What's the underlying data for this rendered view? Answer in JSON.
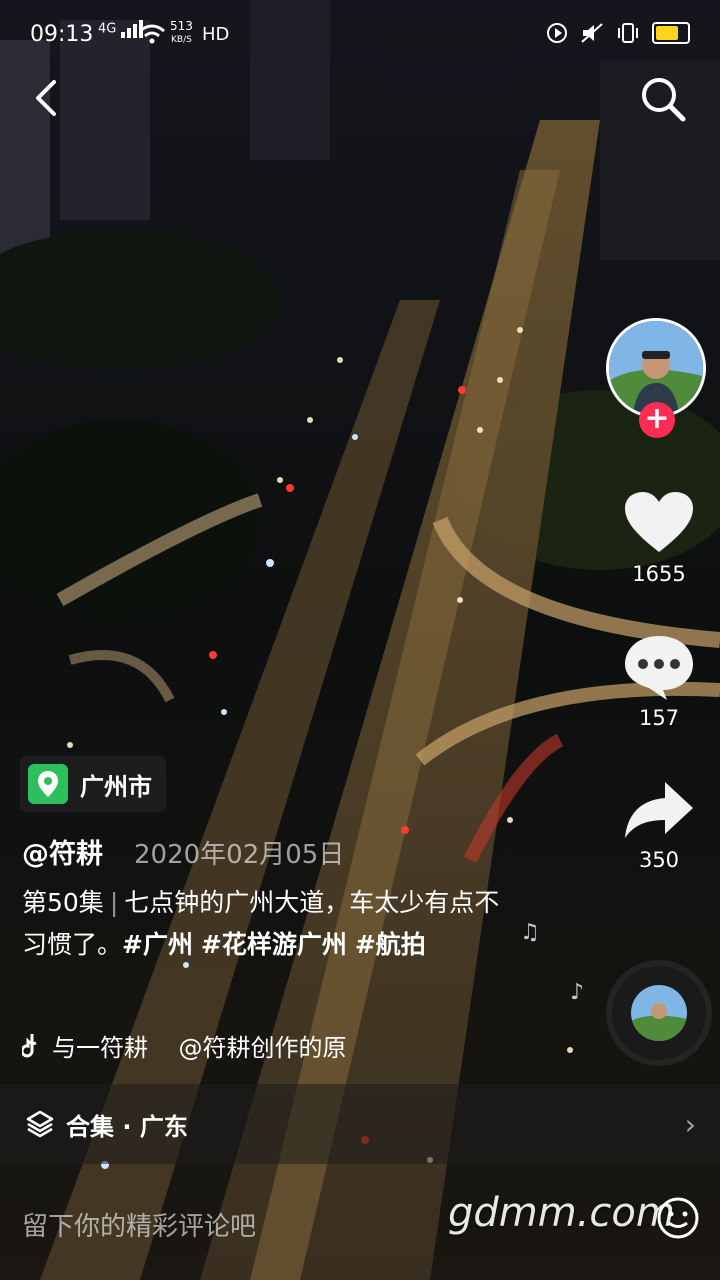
{
  "status_bar": {
    "time": "09:13",
    "network": "4G",
    "speed_value": "513",
    "speed_unit": "KB/S",
    "hd": "HD"
  },
  "location": {
    "name": "广州市"
  },
  "post": {
    "author": "@符耕",
    "date": "2020年02月05日",
    "episode": "第50集",
    "text": "七点钟的广州大道，车太少有点不习惯了。",
    "tags": [
      "#广州",
      "#花样游广州",
      "#航拍"
    ]
  },
  "music": {
    "text": "与一符耕    @符耕创作的原"
  },
  "actions": {
    "likes": "1655",
    "comments": "157",
    "shares": "350"
  },
  "collection": {
    "label": "合集 · 广东"
  },
  "comment_input": {
    "placeholder": "留下你的精彩评论吧"
  },
  "watermark": "gdmm.com",
  "colors": {
    "follow": "#fe2c55",
    "location_pin": "#2ebf5d",
    "battery": "#ffd21e"
  },
  "icons": [
    "back-icon",
    "search-icon",
    "heart-icon",
    "comment-icon",
    "share-icon",
    "location-pin-icon",
    "music-note-icon",
    "layers-icon",
    "emoji-icon"
  ]
}
